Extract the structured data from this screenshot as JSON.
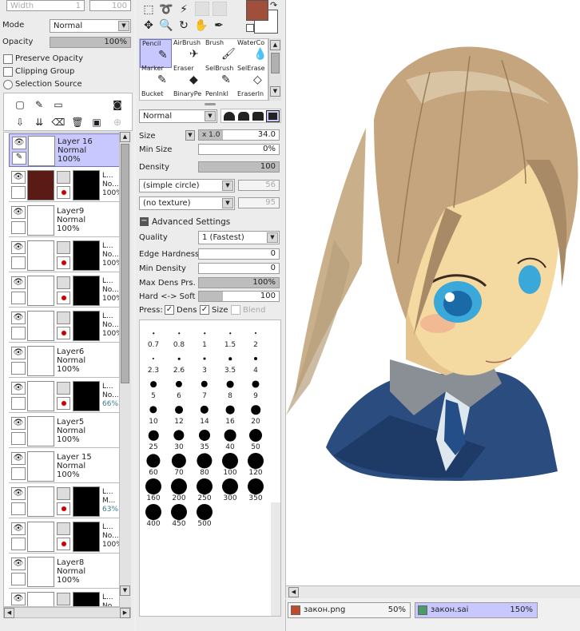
{
  "top_fields": {
    "width_label": "Width",
    "width_value": "1",
    "zoom_value": "100"
  },
  "layer_panel": {
    "mode_label": "Mode",
    "mode_value": "Normal",
    "opacity_label": "Opacity",
    "opacity_value": "100%",
    "opacity_fraction": 1.0,
    "preserve_opacity": "Preserve Opacity",
    "clipping_group": "Clipping Group",
    "selection_source": "Selection Source",
    "layers": [
      {
        "name": "Layer 16",
        "mode": "Normal",
        "opacity": "100%",
        "active": true,
        "masked": false
      },
      {
        "name": "L...",
        "mode": "No...",
        "opacity": "100%",
        "active": false,
        "masked": true,
        "thumb_color": "#5a1a16"
      },
      {
        "name": "Layer9",
        "mode": "Normal",
        "opacity": "100%",
        "active": false,
        "masked": false
      },
      {
        "name": "L...",
        "mode": "No...",
        "opacity": "100%",
        "active": false,
        "masked": true
      },
      {
        "name": "L...",
        "mode": "No...",
        "opacity": "100%",
        "active": false,
        "masked": true
      },
      {
        "name": "L...",
        "mode": "No...",
        "opacity": "100%",
        "active": false,
        "masked": true
      },
      {
        "name": "Layer6",
        "mode": "Normal",
        "opacity": "100%",
        "active": false,
        "masked": false
      },
      {
        "name": "L...",
        "mode": "No...",
        "opacity": "66%",
        "active": false,
        "masked": true
      },
      {
        "name": "Layer5",
        "mode": "Normal",
        "opacity": "100%",
        "active": false,
        "masked": false
      },
      {
        "name": "Layer 15",
        "mode": "Normal",
        "opacity": "100%",
        "active": false,
        "masked": false
      },
      {
        "name": "L...",
        "mode": "M...",
        "opacity": "63%",
        "active": false,
        "masked": true
      },
      {
        "name": "L...",
        "mode": "No...",
        "opacity": "100%",
        "active": false,
        "masked": true
      },
      {
        "name": "Layer8",
        "mode": "Normal",
        "opacity": "100%",
        "active": false,
        "masked": false
      },
      {
        "name": "L...",
        "mode": "No...",
        "opacity": "",
        "active": false,
        "masked": true
      }
    ]
  },
  "colors": {
    "primary": "#a0503a",
    "secondary": "#ffffff",
    "accent": "#c8c8ff"
  },
  "brush_tools": [
    {
      "label": "Pencil",
      "icon": "pencil-icon",
      "glyph": "✎"
    },
    {
      "label": "AirBrush",
      "icon": "airbrush-icon",
      "glyph": "✈"
    },
    {
      "label": "Brush",
      "icon": "brush-icon",
      "glyph": "🖌"
    },
    {
      "label": "WaterCo",
      "icon": "watercolor-icon",
      "glyph": "💧"
    },
    {
      "label": "Marker",
      "icon": "marker-icon",
      "glyph": "✎"
    },
    {
      "label": "Eraser",
      "icon": "eraser-icon",
      "glyph": "◆"
    },
    {
      "label": "SelBrush",
      "icon": "selbrush-icon",
      "glyph": "✎"
    },
    {
      "label": "SelErase",
      "icon": "selerase-icon",
      "glyph": "◇"
    },
    {
      "label": "Bucket",
      "icon": "bucket-icon",
      "glyph": ""
    },
    {
      "label": "BinaryPe",
      "icon": "binarypen-icon",
      "glyph": ""
    },
    {
      "label": "PenInkl",
      "icon": "peninkl-icon",
      "glyph": ""
    },
    {
      "label": "EraserIn",
      "icon": "eraserin-icon",
      "glyph": ""
    }
  ],
  "brush_settings": {
    "blend_mode": "Normal",
    "size_label": "Size",
    "size_mult": "x 1.0",
    "size_value": "34.0",
    "min_size_label": "Min Size",
    "min_size_value": "0%",
    "density_label": "Density",
    "density_value": "100",
    "shape": "(simple circle)",
    "shape_value": "56",
    "texture": "(no texture)",
    "texture_value": "95",
    "advanced": "Advanced Settings",
    "quality_label": "Quality",
    "quality_value": "1 (Fastest)",
    "edge_hardness_label": "Edge Hardness",
    "edge_hardness_value": "0",
    "min_density_label": "Min Density",
    "min_density_value": "0",
    "max_dens_label": "Max Dens Prs.",
    "max_dens_value": "100%",
    "hard_soft_label": "Hard <-> Soft",
    "hard_soft_value": "100",
    "hard_soft_fraction": 0.3,
    "press_label": "Press:",
    "press_dens": "Dens",
    "press_size": "Size",
    "press_blend": "Blend"
  },
  "brush_sizes": [
    "0.7",
    "0.8",
    "1",
    "1.5",
    "2",
    "2.3",
    "2.6",
    "3",
    "3.5",
    "4",
    "5",
    "6",
    "7",
    "8",
    "9",
    "10",
    "12",
    "14",
    "16",
    "20",
    "25",
    "30",
    "35",
    "40",
    "50",
    "60",
    "70",
    "80",
    "100",
    "120",
    "160",
    "200",
    "250",
    "300",
    "350",
    "400",
    "450",
    "500"
  ],
  "tabs": [
    {
      "name": "закон.png",
      "zoom": "50%",
      "active": false
    },
    {
      "name": "закон.sai",
      "zoom": "150%",
      "active": true
    }
  ]
}
